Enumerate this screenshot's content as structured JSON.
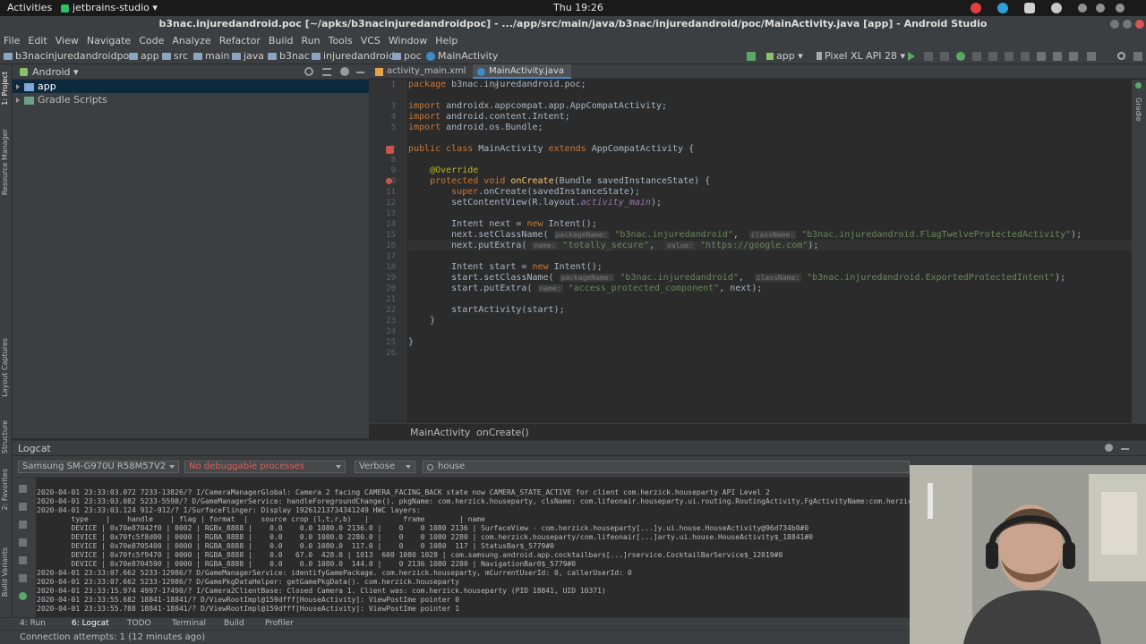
{
  "desktop": {
    "activities": "Activities",
    "app_name": "jetbrains-studio",
    "clock": "Thu 19:26"
  },
  "window": {
    "title": "b3nac.injuredandroid.poc [~/apks/b3nacinjuredandroidpoc] - .../app/src/main/java/b3nac/injuredandroid/poc/MainActivity.java [app] - Android Studio"
  },
  "menu": [
    "File",
    "Edit",
    "View",
    "Navigate",
    "Code",
    "Analyze",
    "Refactor",
    "Build",
    "Run",
    "Tools",
    "VCS",
    "Window",
    "Help"
  ],
  "breadcrumb": [
    "b3nacinjuredandroidpoc",
    "app",
    "src",
    "main",
    "java",
    "b3nac",
    "injuredandroid",
    "poc",
    "MainActivity"
  ],
  "run_config": {
    "module": "app",
    "device": "Pixel XL API 28"
  },
  "project_panel": {
    "view": "Android",
    "tree": [
      "app",
      "Gradle Scripts"
    ]
  },
  "left_strip_tabs": [
    "1: Project",
    "Resource Manager",
    "Layout Captures",
    "Structure",
    "2: Favorites",
    "Build Variants"
  ],
  "right_strip_tabs": [
    "Gradle"
  ],
  "editor": {
    "tabs": [
      "activity_main.xml",
      "MainActivity.java"
    ],
    "active_tab": "MainActivity.java",
    "line_numbers": [
      "1",
      "",
      "3",
      "4",
      "5",
      "",
      "7",
      "8",
      "9",
      "10",
      "11",
      "12",
      "13",
      "14",
      "15",
      "16",
      "17",
      "18",
      "19",
      "20",
      "21",
      "22",
      "23",
      "24",
      "25",
      "26"
    ],
    "hints": {
      "package_name": "packageName:",
      "class_name": "className:",
      "name": "name:",
      "value": "value:"
    },
    "footer": [
      "MainActivity",
      "onCreate()"
    ]
  },
  "logcat": {
    "title": "Logcat",
    "device": "Samsung SM-G970U R58M57V2",
    "process": "No debuggable processes",
    "level": "Verbose",
    "filter": "house",
    "lines": [
      "2020-04-01 23:33:03.072 7233-13826/? I/CameraManagerGlobal: Camera 2 facing CAMERA_FACING_BACK state now CAMERA_STATE_ACTIVE for client com.herzick.houseparty API Level 2",
      "2020-04-01 23:33:03.082 5233-5598/? D/GameManagerService: handleForegroundChange(). pkgName: com.herzick.houseparty, clsName: com.lifeonair.houseparty.ui.routing.RoutingActivity,FgActivityName:com.herzick.hous",
      "2020-04-01 23:33:03.124 912-912/? I/SurfaceFlinger: Display 19261213734341249 HWC layers:",
      "        type    |    handle    | flag | format  |   source crop (l,t,r,b)   |        frame        | name",
      "        DEVICE | 0x70e87042f0 | 0002 | RGBx_8888 |    0.0    0.0 1080.0 2136.0 |    0    0 1080 2136 | SurfaceView - com.herzick.houseparty[...]y.ui.house.HouseActivity@96d734b0#0",
      "        DEVICE | 0x70fc5f8d00 | 0000 | RGBA_8888 |    0.0    0.0 1080.0 2280.0 |    0    0 1080 2280 | com.herzick.houseparty/com.lifeonair[...]arty.ui.house.HouseActivity$_18841#0",
      "        DEVICE | 0x70e8705400 | 0000 | RGBA_8888 |    0.0    0.0 1080.0  117.0 |    0    0 1080  117 | StatusBar$_5779#0",
      "        DEVICE | 0x70fc5f9470 | 0000 | RGBA_8888 |    0.0   67.0  428.0 | 1013  600 1080 1028 | com.samsung.android.app.cocktailbars[...]rservice.CocktailBarService$_12019#0",
      "        DEVICE | 0x70e8704590 | 0000 | RGBA_8888 |    0.0    0.0 1080.0  144.0 |    0 2136 1080 2280 | NavigationBar0$_5779#0",
      "2020-04-01 23:33:07.662 5233-12986/? D/GameManagerService: identifyGamePackage. com.herzick.houseparty, mCurrentUserId: 0, callerUserId: 0",
      "2020-04-01 23:33:07.662 5233-12986/? D/GamePkgDataHelper: getGamePkgData(). com.herzick.houseparty",
      "2020-04-01 23:33:15.974 4997-17490/? I/Camera2ClientBase: Closed Camera 1. Client was: com.herzick.houseparty (PID 18841, UID 10371)",
      "2020-04-01 23:33:55.682 18841-18841/? D/ViewRootImpl@159dfff[HouseActivity]: ViewPostIme pointer 0",
      "2020-04-01 23:33:55.788 18841-18841/? D/ViewRootImpl@159dfff[HouseActivity]: ViewPostIme pointer 1"
    ]
  },
  "bottom_tabs": [
    "4: Run",
    "6: Logcat",
    "TODO",
    "Terminal",
    "Build",
    "Profiler"
  ],
  "status": "Connection attempts: 1 (12 minutes ago)",
  "colors": {
    "editor_bg": "#2b2b2b",
    "panel_bg": "#3c3f41",
    "keyword": "#cc7832",
    "string": "#6a8759",
    "annotation": "#bbb529",
    "method": "#ffc66d",
    "field": "#9876aa",
    "selection": "#0d293e"
  }
}
